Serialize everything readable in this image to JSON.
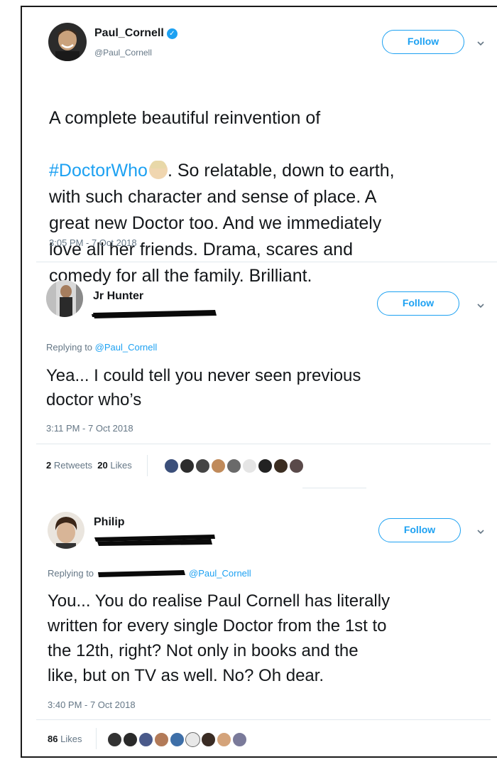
{
  "tweets": [
    {
      "name": "Paul_Cornell",
      "handle": "@Paul_Cornell",
      "verified": true,
      "follow_label": "Follow",
      "text_before": "A complete beautiful reinvention of",
      "hashtag": "#DoctorWho",
      "text_after": ".  So relatable, down to earth,\nwith such character and sense of place.  A\ngreat new Doctor too.  And we immediately\nlove all her friends.  Drama, scares and\ncomedy for all the family. Brilliant.",
      "timestamp": "3:05 PM - 7 Oct 2018"
    },
    {
      "name": "Jr Hunter",
      "follow_label": "Follow",
      "replying_prefix": "Replying to ",
      "replying_handle": "@Paul_Cornell",
      "text": "Yea... I could tell you never seen previous\ndoctor who’s",
      "timestamp": "3:11 PM - 7 Oct 2018",
      "retweets_count": "2",
      "retweets_label": "Retweets",
      "likes_count": "20",
      "likes_label": "Likes"
    },
    {
      "name": "Philip",
      "follow_label": "Follow",
      "replying_prefix": "Replying to",
      "replying_handle": "@Paul_Cornell",
      "text": "You... You do realise Paul Cornell has literally\nwritten for every single Doctor from the 1st to\nthe 12th, right? Not only in books and the\nlike, but on TV as well. No? Oh dear.",
      "timestamp": "3:40 PM - 7 Oct 2018",
      "likes_count": "86",
      "likes_label": "Likes"
    }
  ],
  "colors": {
    "accent": "#1da1f2",
    "text": "#14171a",
    "muted": "#657786"
  },
  "icons": [
    "verified-badge-icon",
    "chevron-down-icon",
    "face-emoji-icon"
  ]
}
